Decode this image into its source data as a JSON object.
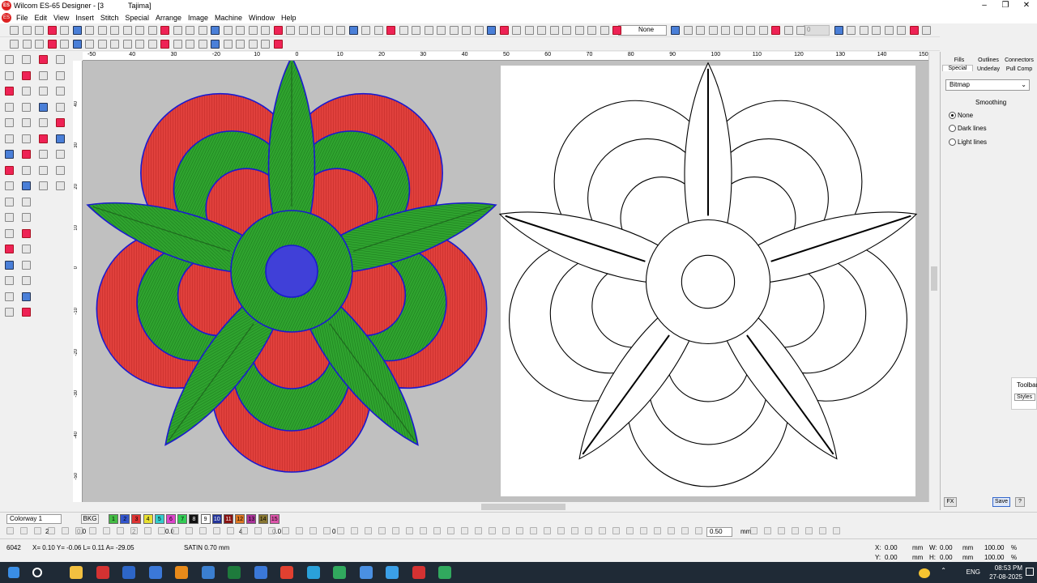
{
  "window": {
    "title": "Wilcom ES-65 Designer - [3",
    "title2": "Tajima]",
    "app_icon": "ES"
  },
  "menu": {
    "items": [
      "File",
      "Edit",
      "View",
      "Insert",
      "Stitch",
      "Special",
      "Arrange",
      "Image",
      "Machine",
      "Window",
      "Help"
    ]
  },
  "toolbar": {
    "thread_mode": "None",
    "stitch_count": "0"
  },
  "ruler": {
    "top": [
      "-50",
      "40",
      "30",
      "-20",
      "10",
      "0",
      "10",
      "20",
      "30",
      "40",
      "50",
      "60",
      "70",
      "80",
      "90",
      "100",
      "110",
      "120",
      "130",
      "140",
      "150"
    ],
    "left": [
      "40",
      "30",
      "20",
      "10",
      "0",
      "-10",
      "-20",
      "-30",
      "-40",
      "-50"
    ]
  },
  "right_panel": {
    "tabs": [
      "Fills",
      "Outlines",
      "Connectors",
      "Special",
      "Underlay",
      "Pull Comp"
    ],
    "dropdown": "Bitmap",
    "section": "Smoothing",
    "options": [
      "None",
      "Dark lines",
      "Light lines"
    ],
    "selected": "None",
    "fx": "FX",
    "save": "Save",
    "help": "?"
  },
  "floater": {
    "line1": "Toolbar",
    "line2": "Styles"
  },
  "colorbar": {
    "colorway": "Colorway 1",
    "bkg": "BKG",
    "swatches": [
      {
        "n": "1",
        "c": "#44bb44"
      },
      {
        "n": "2",
        "c": "#3355cc"
      },
      {
        "n": "3",
        "c": "#dd3333"
      },
      {
        "n": "4",
        "c": "#e8e030"
      },
      {
        "n": "5",
        "c": "#33cccc"
      },
      {
        "n": "6",
        "c": "#dd44cc"
      },
      {
        "n": "7",
        "c": "#33cc55"
      },
      {
        "n": "8",
        "c": "#111111"
      },
      {
        "n": "9",
        "c": "#ffffff"
      },
      {
        "n": "10",
        "c": "#223399"
      },
      {
        "n": "11",
        "c": "#881111"
      },
      {
        "n": "12",
        "c": "#dd7722"
      },
      {
        "n": "13",
        "c": "#aa3399"
      },
      {
        "n": "14",
        "c": "#887733"
      },
      {
        "n": "15",
        "c": "#dd55aa"
      }
    ]
  },
  "bottom": {
    "density": "0.50",
    "unit": "mm",
    "vals": [
      "2",
      "0.0",
      "2",
      "0.0",
      "4",
      "0.0",
      "0"
    ]
  },
  "status": {
    "count": "6042",
    "coords": "X=  0.10 Y= -0.06 L=  0.11 A= -29.05",
    "stitch_type": "SATIN  0.70 mm",
    "x": "X:",
    "y": "Y:",
    "w": "W:",
    "h": "H:",
    "xv": "0.00",
    "yv": "0.00",
    "wv": "0.00",
    "hv": "0.00",
    "mm": "mm",
    "pct1": "100.00",
    "pct2": "100.00",
    "pct": "%"
  },
  "tray": {
    "lang": "ENG",
    "time": "08:53 PM",
    "date": "27-08-2025"
  }
}
